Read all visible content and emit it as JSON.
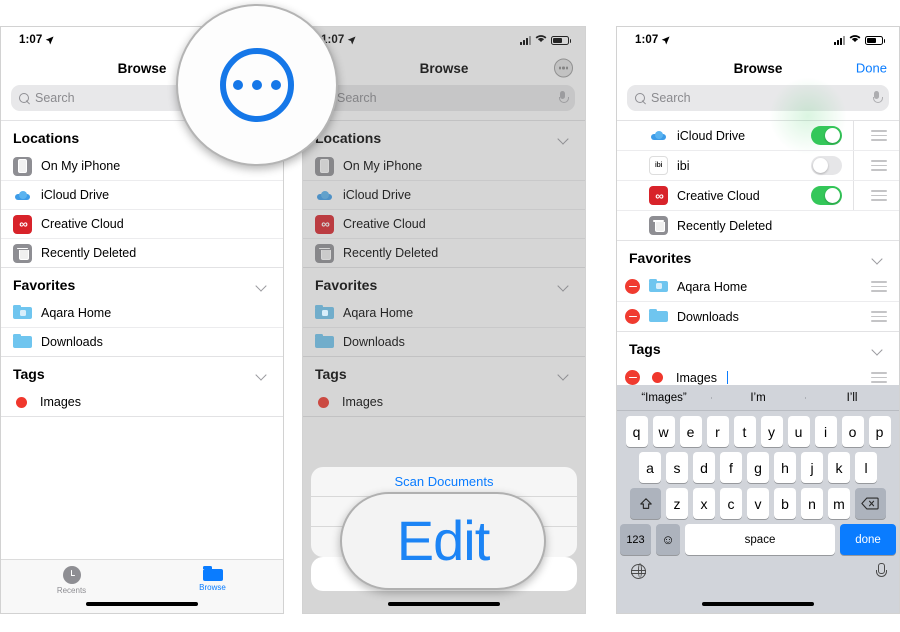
{
  "statusbar": {
    "time": "1:07",
    "location_icon": "location-arrow-icon"
  },
  "panel1": {
    "nav_title": "Browse",
    "search": {
      "placeholder": "Search",
      "icon": "search-icon"
    },
    "sections": [
      {
        "title": "Locations",
        "collapsible": false,
        "rows": [
          {
            "label": "On My iPhone",
            "icon": "iphone-icon"
          },
          {
            "label": "iCloud Drive",
            "icon": "icloud-icon"
          },
          {
            "label": "Creative Cloud",
            "icon": "creative-cloud-icon"
          },
          {
            "label": "Recently Deleted",
            "icon": "trash-icon"
          }
        ]
      },
      {
        "title": "Favorites",
        "collapsible": true,
        "rows": [
          {
            "label": "Aqara Home",
            "icon": "folder-special-icon"
          },
          {
            "label": "Downloads",
            "icon": "folder-icon"
          }
        ]
      },
      {
        "title": "Tags",
        "collapsible": true,
        "rows": [
          {
            "label": "Images",
            "icon": "red-tag-dot-icon"
          }
        ]
      }
    ],
    "tabbar": [
      {
        "label": "Recents",
        "icon": "clock-icon",
        "active": false
      },
      {
        "label": "Browse",
        "icon": "folder-tab-icon",
        "active": true
      }
    ]
  },
  "panel2": {
    "nav_title": "Browse",
    "more_button": "ellipsis-circle-icon",
    "search": {
      "placeholder": "Search",
      "icon": "search-icon"
    },
    "sections": [
      {
        "title": "Locations",
        "collapsible": true,
        "rows": [
          {
            "label": "On My iPhone",
            "icon": "iphone-icon"
          },
          {
            "label": "iCloud Drive",
            "icon": "icloud-icon"
          },
          {
            "label": "Creative Cloud",
            "icon": "creative-cloud-icon"
          },
          {
            "label": "Recently Deleted",
            "icon": "trash-icon"
          }
        ]
      },
      {
        "title": "Favorites",
        "collapsible": true,
        "rows": [
          {
            "label": "Aqara Home",
            "icon": "folder-special-icon"
          },
          {
            "label": "Downloads",
            "icon": "folder-icon"
          }
        ]
      },
      {
        "title": "Tags",
        "collapsible": true,
        "rows": [
          {
            "label": "Images",
            "icon": "red-tag-dot-icon"
          }
        ]
      }
    ],
    "action_sheet": {
      "items": [
        "Scan Documents",
        "",
        ""
      ],
      "cancel": ""
    }
  },
  "panel3": {
    "nav_title": "Browse",
    "done_label": "Done",
    "search": {
      "placeholder": "Search",
      "icon": "search-icon"
    },
    "edit_rows": [
      {
        "label": "iCloud Drive",
        "icon": "icloud-icon",
        "toggle": "on",
        "handle": "reorder-handle-icon"
      },
      {
        "label": "ibi",
        "icon": "ibi-icon",
        "toggle": "off",
        "handle": "reorder-handle-icon"
      },
      {
        "label": "Creative Cloud",
        "icon": "creative-cloud-icon",
        "toggle": "on",
        "handle": "reorder-handle-icon"
      },
      {
        "label": "Recently Deleted",
        "icon": "trash-icon",
        "toggle": "none",
        "handle": ""
      }
    ],
    "sections": [
      {
        "title": "Favorites",
        "rows": [
          {
            "label": "Aqara Home",
            "icon": "folder-special-icon",
            "remove": true
          },
          {
            "label": "Downloads",
            "icon": "folder-icon",
            "remove": true
          }
        ]
      },
      {
        "title": "Tags",
        "rows": [
          {
            "label": "Images",
            "icon": "red-tag-dot-icon",
            "remove": true,
            "editing": true
          }
        ]
      }
    ],
    "keyboard": {
      "predictions": [
        "“Images”",
        "I’m",
        "I’ll"
      ],
      "row1": [
        "q",
        "w",
        "e",
        "r",
        "t",
        "y",
        "u",
        "i",
        "o",
        "p"
      ],
      "row2": [
        "a",
        "s",
        "d",
        "f",
        "g",
        "h",
        "j",
        "k",
        "l"
      ],
      "row3": [
        "z",
        "x",
        "c",
        "v",
        "b",
        "n",
        "m"
      ],
      "shift": "shift-icon",
      "backspace": "backspace-icon",
      "numbers": "123",
      "emoji": "emoji-icon",
      "space": "space",
      "done": "done",
      "globe": "globe-icon",
      "dictation": "microphone-icon"
    }
  },
  "callouts": {
    "ellipsis_magnifier": "ellipsis-circle-icon",
    "edit_label": "Edit"
  },
  "colors": {
    "accent_blue": "#0a7cff",
    "toggle_green": "#34c759",
    "destructive_red": "#f03b30",
    "tag_red": "#f0372c",
    "creative_cloud_red": "#d8232a"
  }
}
